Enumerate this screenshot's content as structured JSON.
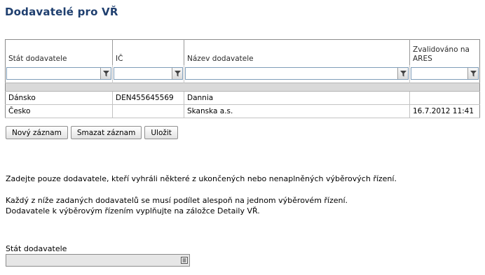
{
  "page": {
    "title": "Dodavatelé pro VŘ"
  },
  "grid": {
    "columns": [
      "Stát dodavatele",
      "IČ",
      "Název dodavatele",
      "Zvalidováno na ARES"
    ],
    "rows": [
      [
        "Dánsko",
        "DEN455645569",
        "Dannia",
        ""
      ],
      [
        "Česko",
        "",
        "Skanska a.s.",
        "16.7.2012 11:41"
      ]
    ]
  },
  "toolbar": {
    "new_label": "Nový záznam",
    "delete_label": "Smazat záznam",
    "save_label": "Uložit"
  },
  "info": {
    "line1": "Zadejte pouze dodavatele, kteří vyhráli některé z ukončených nebo nenaplněných výběrových řízení.",
    "line2": "Každý z níže zadaných dodavatelů se musí podílet alespoň na jednom výběrovém řízení.",
    "line3": "Dodavatele k výběrovým řízením vyplňujte na záložce Detaily VŘ."
  },
  "form": {
    "country_label": "Stát dodavatele",
    "country_value": ""
  },
  "icons": {
    "filter": "funnel-icon",
    "list": "list-icon"
  },
  "colors": {
    "title": "#1f3f6f",
    "separator": "#d9d9d9",
    "disabled_field": "#e6e6e6"
  }
}
